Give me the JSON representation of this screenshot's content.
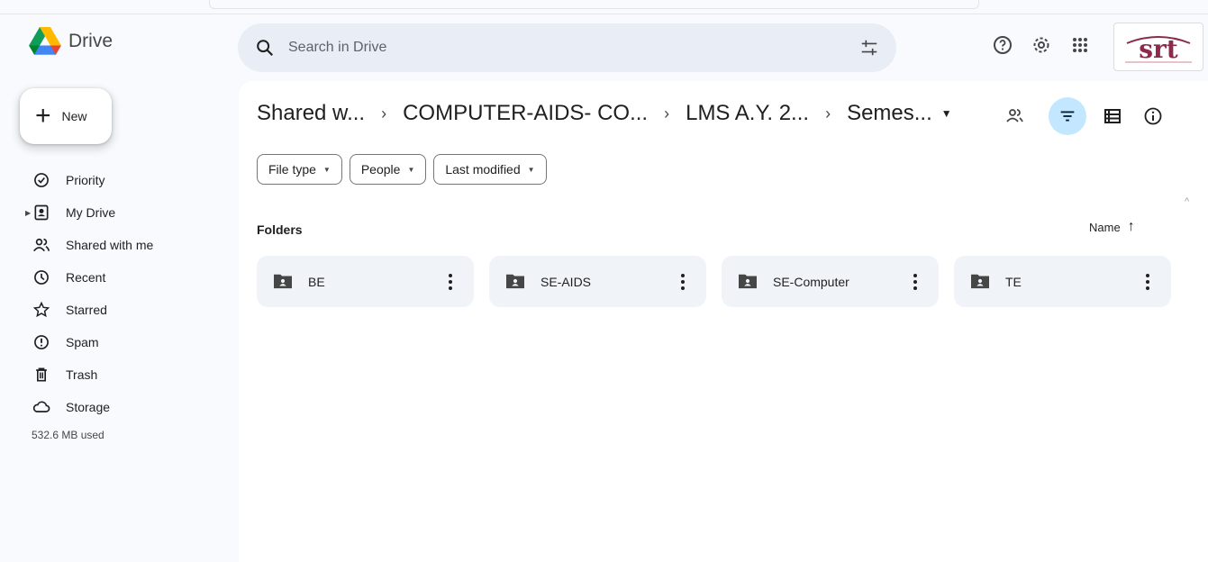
{
  "app": {
    "name": "Drive"
  },
  "search": {
    "placeholder": "Search in Drive"
  },
  "sidebar": {
    "new_label": "New",
    "items": [
      {
        "label": "Priority",
        "icon": "priority-icon"
      },
      {
        "label": "My Drive",
        "icon": "my-drive-icon"
      },
      {
        "label": "Shared with me",
        "icon": "shared-icon"
      },
      {
        "label": "Recent",
        "icon": "clock-icon"
      },
      {
        "label": "Starred",
        "icon": "star-icon"
      },
      {
        "label": "Spam",
        "icon": "spam-icon"
      },
      {
        "label": "Trash",
        "icon": "trash-icon"
      },
      {
        "label": "Storage",
        "icon": "cloud-icon"
      }
    ],
    "storage_used": "532.6 MB used"
  },
  "breadcrumb": [
    "Shared w...",
    "COMPUTER-AIDS- CO...",
    "LMS A.Y. 2...",
    "Semes..."
  ],
  "chips": [
    "File type",
    "People",
    "Last modified"
  ],
  "section": {
    "title": "Folders",
    "sort_label": "Name"
  },
  "folders": [
    {
      "name": "BE"
    },
    {
      "name": "SE-AIDS"
    },
    {
      "name": "SE-Computer"
    },
    {
      "name": "TE"
    }
  ],
  "colors": {
    "accent": "#c2e7ff",
    "background": "#f8fafd",
    "card": "#f0f4f9"
  },
  "avatar": {
    "text": "srt"
  }
}
